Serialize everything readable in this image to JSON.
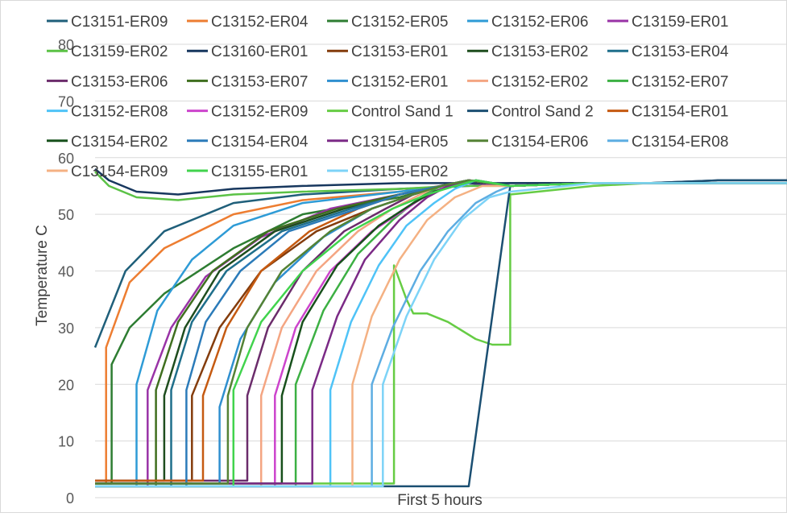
{
  "chart_data": {
    "type": "line",
    "title": "",
    "xlabel": "First 5 hours",
    "ylabel": "Temperature C",
    "ylim": [
      0,
      80
    ],
    "y_ticks": [
      0,
      10,
      20,
      30,
      40,
      50,
      60,
      70,
      80
    ],
    "xlim": [
      0,
      5
    ],
    "grid": true,
    "legend_position": "top",
    "series": [
      {
        "name": "C13151-ER09",
        "color": "#1f5f7a",
        "x": [
          0,
          0.22,
          0.5,
          1.0,
          1.5,
          2.2,
          2.7,
          3.0,
          3.6,
          4.0,
          4.5,
          5.0
        ],
        "y": [
          26.5,
          40,
          47,
          52,
          53.5,
          54.5,
          55,
          55.5,
          55.5,
          55.5,
          55.5,
          55.5
        ]
      },
      {
        "name": "C13152-ER04",
        "color": "#ed7d31",
        "x": [
          0,
          0.08,
          0.08,
          0.25,
          0.5,
          1.0,
          1.5,
          2.2,
          2.5,
          2.7,
          3.0,
          3.6,
          4.0,
          4.5,
          5.0
        ],
        "y": [
          2.5,
          2.5,
          26.5,
          38,
          44,
          50,
          52.5,
          54,
          55,
          55.5,
          55,
          55.5,
          55.5,
          55.5,
          55.5
        ]
      },
      {
        "name": "C13152-ER05",
        "color": "#2e7d32",
        "x": [
          0,
          0.12,
          0.12,
          0.25,
          0.5,
          1.0,
          1.5,
          2.2,
          2.5,
          2.7,
          3.0,
          3.6,
          4.0,
          4.5,
          5.0
        ],
        "y": [
          2.5,
          2.5,
          23.5,
          30,
          36,
          44,
          50,
          53,
          55,
          55.5,
          55,
          55.5,
          55.5,
          55.5,
          55.5
        ]
      },
      {
        "name": "C13152-ER06",
        "color": "#2e9bd6",
        "x": [
          0,
          0.25,
          0.3,
          0.3,
          0.45,
          0.7,
          1.0,
          1.5,
          2.2,
          2.7,
          3.0,
          3.6,
          4.0,
          4.5,
          5.0
        ],
        "y": [
          2,
          2,
          2,
          20,
          33,
          42,
          48,
          52,
          54,
          55.5,
          55,
          55.5,
          55.5,
          55.5,
          55.5
        ]
      },
      {
        "name": "C13159-ER01",
        "color": "#9933a6",
        "x": [
          0,
          0.38,
          0.38,
          0.55,
          0.8,
          1.2,
          1.7,
          2.2,
          2.5,
          2.7,
          3.0,
          3.6,
          4.0,
          4.5,
          5.0
        ],
        "y": [
          2,
          2,
          19,
          30,
          39,
          46,
          51,
          53.5,
          55,
          55.5,
          55,
          55.5,
          55.5,
          55.5,
          55.5
        ]
      },
      {
        "name": "C13159-ER02",
        "color": "#5bc246",
        "x": [
          0,
          0.1,
          0.3,
          0.6,
          1.0,
          1.5,
          2.2,
          2.6,
          3.0,
          3.6,
          4.0,
          4.5,
          5.0
        ],
        "y": [
          57.5,
          55,
          53,
          52.5,
          53.5,
          54,
          54.5,
          55,
          55,
          55.5,
          55.5,
          55.5,
          55.5
        ]
      },
      {
        "name": "C13160-ER01",
        "color": "#17375e",
        "x": [
          0,
          0.1,
          0.3,
          0.6,
          1.0,
          1.5,
          2.2,
          2.6,
          3.0,
          3.6,
          4.0,
          4.5,
          5.0
        ],
        "y": [
          58,
          56,
          54,
          53.5,
          54.5,
          55,
          55.5,
          55.5,
          55.5,
          55.5,
          55.5,
          56,
          56
        ]
      },
      {
        "name": "C13153-ER01",
        "color": "#843c0c",
        "x": [
          0,
          0.7,
          0.7,
          0.9,
          1.2,
          1.6,
          2.0,
          2.3,
          2.5,
          2.7,
          3.0,
          3.6,
          4.0,
          4.5,
          5.0
        ],
        "y": [
          3,
          3,
          18,
          30,
          40,
          47,
          51,
          53.5,
          55,
          56,
          55,
          55.5,
          55.5,
          55.5,
          55.5
        ]
      },
      {
        "name": "C13153-ER02",
        "color": "#1e4d1e",
        "x": [
          0,
          0.5,
          0.5,
          0.65,
          0.9,
          1.3,
          1.8,
          2.2,
          2.5,
          2.7,
          3.0,
          3.6,
          4.0,
          4.5,
          5.0
        ],
        "y": [
          3,
          3,
          18,
          30,
          40,
          47,
          51,
          53.5,
          55,
          56,
          55,
          55.5,
          55.5,
          55.5,
          55.5
        ]
      },
      {
        "name": "C13153-ER04",
        "color": "#1f6f8b",
        "x": [
          0,
          0.55,
          0.55,
          0.7,
          0.95,
          1.35,
          1.85,
          2.2,
          2.5,
          2.7,
          3.0,
          3.6,
          4.0,
          4.5,
          5.0
        ],
        "y": [
          2,
          2,
          19,
          31,
          40,
          47,
          51,
          53.5,
          55,
          56,
          55,
          55.5,
          55.5,
          55.5,
          55.5
        ]
      },
      {
        "name": "C13153-ER06",
        "color": "#6b2c6b",
        "x": [
          0,
          1.1,
          1.1,
          1.25,
          1.5,
          1.8,
          2.1,
          2.3,
          2.5,
          2.7,
          3.0,
          3.6,
          4.0,
          4.5,
          5.0
        ],
        "y": [
          3,
          3,
          18,
          30,
          40,
          47,
          51,
          53.5,
          55,
          56,
          55,
          55.5,
          55.5,
          55.5,
          55.5
        ]
      },
      {
        "name": "C13153-ER07",
        "color": "#3f6f1f",
        "x": [
          0,
          0.44,
          0.44,
          0.6,
          0.85,
          1.25,
          1.75,
          2.2,
          2.5,
          2.7,
          3.0,
          3.6,
          4.0,
          4.5,
          5.0
        ],
        "y": [
          2,
          2,
          19,
          31,
          40,
          47,
          51,
          53.5,
          55,
          56,
          55,
          55.5,
          55.5,
          55.5,
          55.5
        ]
      },
      {
        "name": "C13152-ER01",
        "color": "#2f8fcf",
        "x": [
          0,
          0.9,
          0.9,
          1.05,
          1.3,
          1.65,
          2.0,
          2.3,
          2.5,
          2.7,
          3.0,
          3.6,
          4.0,
          4.5,
          5.0
        ],
        "y": [
          2.5,
          2.5,
          16,
          28,
          38,
          46,
          51,
          53.5,
          55,
          56,
          55,
          55.5,
          55.5,
          55.5,
          55.5
        ]
      },
      {
        "name": "C13152-ER02",
        "color": "#f4a582",
        "x": [
          0,
          1.2,
          1.2,
          1.35,
          1.6,
          1.9,
          2.15,
          2.35,
          2.5,
          2.7,
          3.0,
          3.6,
          4.0,
          4.5,
          5.0
        ],
        "y": [
          2,
          2,
          18,
          30,
          40,
          47,
          51,
          53.5,
          55,
          56,
          55,
          55.5,
          55.5,
          55.5,
          55.5
        ]
      },
      {
        "name": "C13152-ER07",
        "color": "#3cb043",
        "x": [
          0,
          1.45,
          1.45,
          1.65,
          1.9,
          2.15,
          2.35,
          2.5,
          2.7,
          3.0,
          3.6,
          4.0,
          4.5,
          5.0
        ],
        "y": [
          2,
          2,
          20,
          33,
          43,
          49,
          53,
          55,
          56,
          55,
          55.5,
          55.5,
          55.5,
          55.5
        ]
      },
      {
        "name": "C13152-ER08",
        "color": "#4fc3f7",
        "x": [
          0,
          1.65,
          1.7,
          1.7,
          1.85,
          2.05,
          2.25,
          2.45,
          2.6,
          2.75,
          3.0,
          3.6,
          4.0,
          4.5,
          5.0
        ],
        "y": [
          2,
          2,
          2,
          19,
          31,
          41,
          48,
          52,
          54.5,
          56,
          55,
          55.5,
          55.5,
          55.5,
          55.5
        ]
      },
      {
        "name": "C13152-ER09",
        "color": "#cc44cc",
        "x": [
          0,
          1.3,
          1.3,
          1.45,
          1.7,
          2.0,
          2.25,
          2.4,
          2.55,
          2.7,
          3.0,
          3.6,
          4.0,
          4.5,
          5.0
        ],
        "y": [
          2,
          2,
          18,
          30,
          40,
          47,
          51,
          53.5,
          55,
          56,
          55,
          55.5,
          55.5,
          55.5,
          55.5
        ]
      },
      {
        "name": "Control Sand 1",
        "color": "#66cc44",
        "x": [
          0,
          2.16,
          2.16,
          2.25,
          2.3,
          2.4,
          2.55,
          2.75,
          2.87,
          3.0,
          3.0,
          3.2,
          3.6,
          4.0,
          4.5,
          5.0
        ],
        "y": [
          2.5,
          2.5,
          41,
          35,
          32.5,
          32.5,
          31,
          28,
          27,
          27,
          53.5,
          54,
          55,
          55.5,
          55.5,
          55.5
        ]
      },
      {
        "name": "Control Sand 2",
        "color": "#1b4f72",
        "x": [
          0,
          0.6,
          1.0,
          1.5,
          2.0,
          2.3,
          2.5,
          2.7,
          3.0,
          3.6,
          4.0,
          4.5,
          5.0
        ],
        "y": [
          2,
          2,
          2,
          2,
          2,
          2,
          2,
          2,
          55,
          55.5,
          55.5,
          56,
          56
        ]
      },
      {
        "name": "C13154-ER01",
        "color": "#c55a11",
        "x": [
          0,
          0.78,
          0.78,
          0.95,
          1.2,
          1.55,
          1.9,
          2.2,
          2.5,
          2.7,
          3.0,
          3.6,
          4.0,
          4.5,
          5.0
        ],
        "y": [
          3,
          3,
          18,
          30,
          40,
          47,
          51,
          53.5,
          55,
          56,
          55,
          55.5,
          55.5,
          55.5,
          55.5
        ]
      },
      {
        "name": "C13154-ER02",
        "color": "#17501b",
        "x": [
          0,
          1.35,
          1.35,
          1.5,
          1.75,
          2.05,
          2.3,
          2.45,
          2.6,
          2.75,
          3.0,
          3.6,
          4.0,
          4.5,
          5.0
        ],
        "y": [
          2.5,
          2.5,
          18,
          31,
          41,
          48,
          52,
          54,
          55,
          56,
          55,
          55.5,
          55.5,
          55.5,
          55.5
        ]
      },
      {
        "name": "C13154-ER04",
        "color": "#2b7bb9",
        "x": [
          0,
          0.66,
          0.66,
          0.8,
          1.05,
          1.4,
          1.9,
          2.2,
          2.5,
          2.7,
          3.0,
          3.6,
          4.0,
          4.5,
          5.0
        ],
        "y": [
          2,
          2,
          19,
          31,
          40,
          47,
          51,
          53.5,
          55,
          56,
          55,
          55.5,
          55.5,
          55.5,
          55.5
        ]
      },
      {
        "name": "C13154-ER05",
        "color": "#7b2a86",
        "x": [
          0,
          1.57,
          1.57,
          1.75,
          1.95,
          2.2,
          2.4,
          2.55,
          2.7,
          3.0,
          3.6,
          4.0,
          4.5,
          5.0
        ],
        "y": [
          2.5,
          2.5,
          19,
          32,
          42,
          49,
          53,
          55,
          56,
          55,
          55.5,
          55.5,
          55.5,
          55.5
        ]
      },
      {
        "name": "C13154-ER06",
        "color": "#548235",
        "x": [
          0,
          0.96,
          0.96,
          1.1,
          1.35,
          1.7,
          2.0,
          2.3,
          2.5,
          2.7,
          3.0,
          3.6,
          4.0,
          4.5,
          5.0
        ],
        "y": [
          2.5,
          2.5,
          18,
          30,
          40,
          47,
          51,
          53.5,
          55,
          56,
          55,
          55.5,
          55.5,
          55.5,
          55.5
        ]
      },
      {
        "name": "C13154-ER08",
        "color": "#5dade2",
        "x": [
          0,
          1.8,
          1.9,
          2.0,
          2.0,
          2.15,
          2.35,
          2.55,
          2.75,
          2.9,
          3.0,
          3.6,
          4.0,
          4.5,
          5.0
        ],
        "y": [
          2,
          2,
          2,
          2,
          20,
          30,
          40,
          47,
          52,
          54,
          55,
          55.5,
          55.5,
          55.5,
          55.5
        ]
      },
      {
        "name": "C13154-ER09",
        "color": "#f4b183",
        "x": [
          0,
          1.86,
          1.86,
          2.0,
          2.2,
          2.4,
          2.6,
          2.8,
          3.0,
          3.6,
          4.0,
          4.5,
          5.0
        ],
        "y": [
          2,
          2,
          20,
          32,
          42,
          49,
          53,
          55,
          55,
          55.5,
          55.5,
          55.5,
          55.5
        ]
      },
      {
        "name": "C13155-ER01",
        "color": "#41d34d",
        "x": [
          0,
          1.0,
          1.0,
          1.2,
          1.5,
          1.85,
          2.15,
          2.4,
          2.6,
          2.75,
          3.0,
          3.6,
          4.0,
          4.5,
          5.0
        ],
        "y": [
          2,
          2,
          19,
          31,
          40,
          47,
          51,
          53.5,
          55,
          56,
          55,
          55.5,
          55.5,
          55.5,
          55.5
        ]
      },
      {
        "name": "C13155-ER02",
        "color": "#7dd3f7",
        "x": [
          0,
          2.08,
          2.08,
          2.25,
          2.45,
          2.65,
          2.85,
          3.0,
          3.6,
          4.0,
          4.5,
          5.0
        ],
        "y": [
          2,
          2,
          20,
          32,
          42,
          49,
          53,
          54,
          55.5,
          55.5,
          55.5,
          55.5
        ]
      }
    ]
  }
}
